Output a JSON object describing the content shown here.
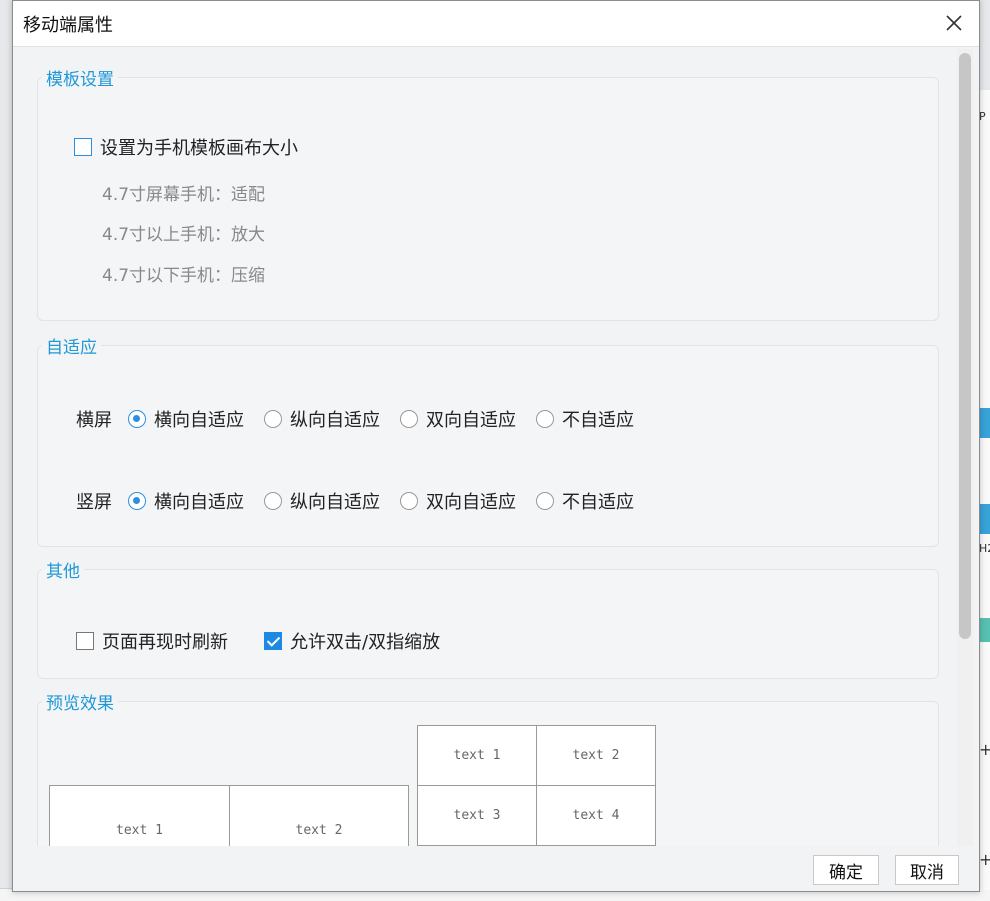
{
  "dialog": {
    "title": "移动端属性",
    "close_icon": "close-icon"
  },
  "template_settings": {
    "legend": "模板设置",
    "checkbox_label": "设置为手机模板画布大小",
    "checked": false,
    "notes": [
      "4.7寸屏幕手机：适配",
      "4.7寸以上手机：放大",
      "4.7寸以下手机：压缩"
    ]
  },
  "adaptive": {
    "legend": "自适应",
    "rows": [
      {
        "label": "横屏",
        "options": [
          "横向自适应",
          "纵向自适应",
          "双向自适应",
          "不自适应"
        ],
        "selected": "横向自适应"
      },
      {
        "label": "竖屏",
        "options": [
          "横向自适应",
          "纵向自适应",
          "双向自适应",
          "不自适应"
        ],
        "selected": "横向自适应"
      }
    ]
  },
  "other": {
    "legend": "其他",
    "options": [
      {
        "label": "页面再现时刷新",
        "checked": false
      },
      {
        "label": "允许双击/双指缩放",
        "checked": true
      }
    ]
  },
  "preview": {
    "legend": "预览效果",
    "landscape_cells": [
      "text 1",
      "text 2"
    ],
    "portrait_cells": [
      "text 1",
      "text 2",
      "text 3",
      "text 4"
    ]
  },
  "footer": {
    "ok_label": "确定",
    "cancel_label": "取消"
  },
  "background": {
    "right_marks": [
      "P",
      "H2",
      "+",
      "+"
    ]
  },
  "colors": {
    "accent": "#1e98d7",
    "checkbox_checked": "#1e88e5",
    "radio_selected": "#2d8fe0"
  }
}
